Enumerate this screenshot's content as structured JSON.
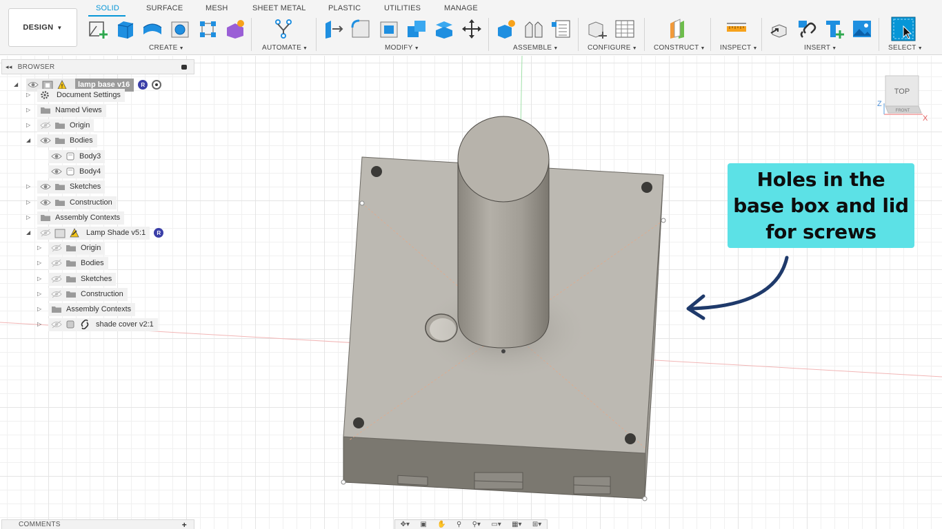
{
  "app": {
    "design_label": "DESIGN",
    "tabs": [
      "SOLID",
      "SURFACE",
      "MESH",
      "SHEET METAL",
      "PLASTIC",
      "UTILITIES",
      "MANAGE"
    ],
    "active_tab": "SOLID",
    "groups": [
      "CREATE",
      "AUTOMATE",
      "MODIFY",
      "ASSEMBLE",
      "CONFIGURE",
      "CONSTRUCT",
      "INSPECT",
      "INSERT",
      "SELECT"
    ],
    "accent_color": "#0696d7"
  },
  "browser": {
    "title": "BROWSER",
    "root": {
      "label": "lamp base v16",
      "warning_icon": "warning-icon",
      "ref_badge": "R"
    },
    "items": [
      "Document Settings",
      "Named Views",
      "Origin",
      "Bodies",
      "Body3",
      "Body4",
      "Sketches",
      "Construction",
      "Assembly Contexts",
      "Lamp Shade v5:1",
      "Origin",
      "Bodies",
      "Sketches",
      "Construction",
      "Assembly Contexts",
      "shade cover v2:1"
    ]
  },
  "viewcube": {
    "top_label": "TOP",
    "front_label": "FRONT",
    "axis_x": "X",
    "axis_z": "Z"
  },
  "callout": {
    "text": "Holes in the\nbase box and lid\nfor screws",
    "color": "#5ce1e6",
    "arrow_color": "#1f3a6b"
  },
  "comments": {
    "title": "COMMENTS"
  }
}
